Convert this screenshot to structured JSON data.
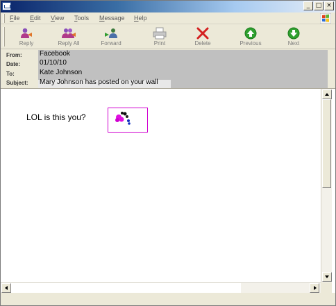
{
  "window": {
    "title": "",
    "controls": [
      "_",
      "□",
      "×"
    ]
  },
  "menu": {
    "items": [
      {
        "label": "File",
        "underline": "F",
        "rest": "ile"
      },
      {
        "label": "Edit",
        "underline": "E",
        "rest": "dit"
      },
      {
        "label": "View",
        "underline": "V",
        "rest": "iew"
      },
      {
        "label": "Tools",
        "underline": "T",
        "rest": "ools"
      },
      {
        "label": "Message",
        "underline": "M",
        "rest": "essage"
      },
      {
        "label": "Help",
        "underline": "H",
        "rest": "elp"
      }
    ]
  },
  "toolbar": {
    "buttons": [
      {
        "label": "Reply",
        "icon": "reply-icon"
      },
      {
        "label": "Reply All",
        "icon": "reply-all-icon"
      },
      {
        "label": "Forward",
        "icon": "forward-icon"
      },
      {
        "label": "Print",
        "icon": "print-icon"
      },
      {
        "label": "Delete",
        "icon": "delete-icon"
      },
      {
        "label": "Previous",
        "icon": "previous-icon"
      },
      {
        "label": "Next",
        "icon": "next-icon"
      }
    ]
  },
  "header": {
    "from_label": "From:",
    "from_value": "Facebook",
    "date_label": "Date:",
    "date_value": "01/10/10",
    "to_label": "To:",
    "to_value": "Kate Johnson",
    "subject_label": "Subject:",
    "subject_value": "Mary Johnson has posted on your wall"
  },
  "message": {
    "body_text": "LOL is this you?",
    "image_icon": "broken-picture-icon"
  },
  "colors": {
    "chrome": "#ece9d8",
    "header_value_bg": "#c0c0c0",
    "picture_border": "#d000d0",
    "delete_red": "#d42020",
    "nav_green": "#2fa02f"
  }
}
